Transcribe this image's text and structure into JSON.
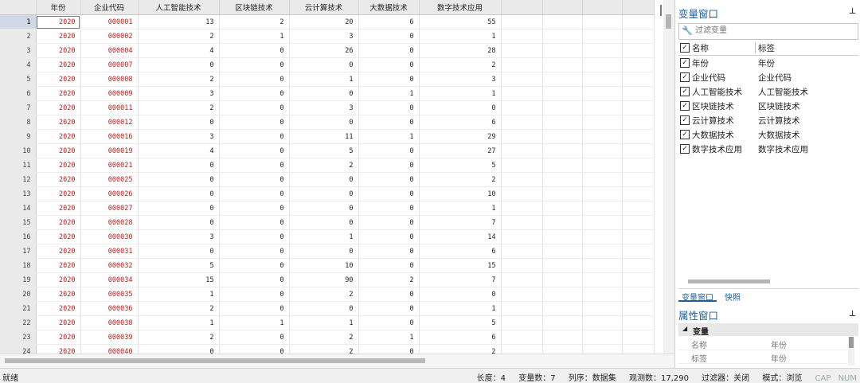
{
  "grid": {
    "columns": [
      "年份",
      "企业代码",
      "人工智能技术",
      "区块链技术",
      "云计算技术",
      "大数据技术",
      "数字技术应用"
    ],
    "selected_row": 0,
    "rows": [
      [
        "1",
        "2020",
        "000001",
        "13",
        "2",
        "20",
        "6",
        "55"
      ],
      [
        "2",
        "2020",
        "000002",
        "2",
        "1",
        "3",
        "0",
        "1"
      ],
      [
        "3",
        "2020",
        "000004",
        "4",
        "0",
        "26",
        "0",
        "28"
      ],
      [
        "4",
        "2020",
        "000007",
        "0",
        "0",
        "0",
        "0",
        "2"
      ],
      [
        "5",
        "2020",
        "000008",
        "2",
        "0",
        "1",
        "0",
        "3"
      ],
      [
        "6",
        "2020",
        "000009",
        "3",
        "0",
        "0",
        "1",
        "1"
      ],
      [
        "7",
        "2020",
        "000011",
        "2",
        "0",
        "3",
        "0",
        "0"
      ],
      [
        "8",
        "2020",
        "000012",
        "0",
        "0",
        "0",
        "0",
        "6"
      ],
      [
        "9",
        "2020",
        "000016",
        "3",
        "0",
        "11",
        "1",
        "29"
      ],
      [
        "10",
        "2020",
        "000019",
        "4",
        "0",
        "5",
        "0",
        "27"
      ],
      [
        "11",
        "2020",
        "000021",
        "0",
        "0",
        "2",
        "0",
        "5"
      ],
      [
        "12",
        "2020",
        "000025",
        "0",
        "0",
        "0",
        "0",
        "2"
      ],
      [
        "13",
        "2020",
        "000026",
        "0",
        "0",
        "0",
        "0",
        "10"
      ],
      [
        "14",
        "2020",
        "000027",
        "0",
        "0",
        "0",
        "0",
        "1"
      ],
      [
        "15",
        "2020",
        "000028",
        "0",
        "0",
        "0",
        "0",
        "7"
      ],
      [
        "16",
        "2020",
        "000030",
        "3",
        "0",
        "1",
        "0",
        "14"
      ],
      [
        "17",
        "2020",
        "000031",
        "0",
        "0",
        "0",
        "0",
        "6"
      ],
      [
        "18",
        "2020",
        "000032",
        "5",
        "0",
        "10",
        "0",
        "15"
      ],
      [
        "19",
        "2020",
        "000034",
        "15",
        "0",
        "90",
        "2",
        "7"
      ],
      [
        "20",
        "2020",
        "000035",
        "1",
        "0",
        "2",
        "0",
        "0"
      ],
      [
        "21",
        "2020",
        "000036",
        "2",
        "0",
        "0",
        "0",
        "1"
      ],
      [
        "22",
        "2020",
        "000038",
        "1",
        "1",
        "1",
        "0",
        "5"
      ],
      [
        "23",
        "2020",
        "000039",
        "2",
        "0",
        "2",
        "1",
        "6"
      ],
      [
        "24",
        "2020",
        "000040",
        "0",
        "0",
        "2",
        "0",
        "2"
      ]
    ]
  },
  "variables_window": {
    "title": "变量窗口",
    "pin_icon": "pin-icon",
    "filter_placeholder": "过滤变量",
    "header_name": "名称",
    "header_label": "标签",
    "items": [
      {
        "name": "年份",
        "label": "年份"
      },
      {
        "name": "企业代码",
        "label": "企业代码"
      },
      {
        "name": "人工智能技术",
        "label": "人工智能技术"
      },
      {
        "name": "区块链技术",
        "label": "区块链技术"
      },
      {
        "name": "云计算技术",
        "label": "云计算技术"
      },
      {
        "name": "大数据技术",
        "label": "大数据技术"
      },
      {
        "name": "数字技术应用",
        "label": "数字技术应用"
      }
    ],
    "tabs": [
      "变量窗口",
      "快照"
    ]
  },
  "properties_window": {
    "title": "属性窗口",
    "section": "变量",
    "rows": [
      {
        "key": "名称",
        "value": "年份"
      },
      {
        "key": "标签",
        "value": "年份"
      }
    ]
  },
  "status_bar": {
    "ready": "就绪",
    "length": "长度：4",
    "vars": "变量数：7",
    "sort": "列序：数据集",
    "obs": "观测数：17,290",
    "filter": "过滤器：关闭",
    "mode": "模式：浏览",
    "cap": "CAP",
    "num": "NUM"
  }
}
